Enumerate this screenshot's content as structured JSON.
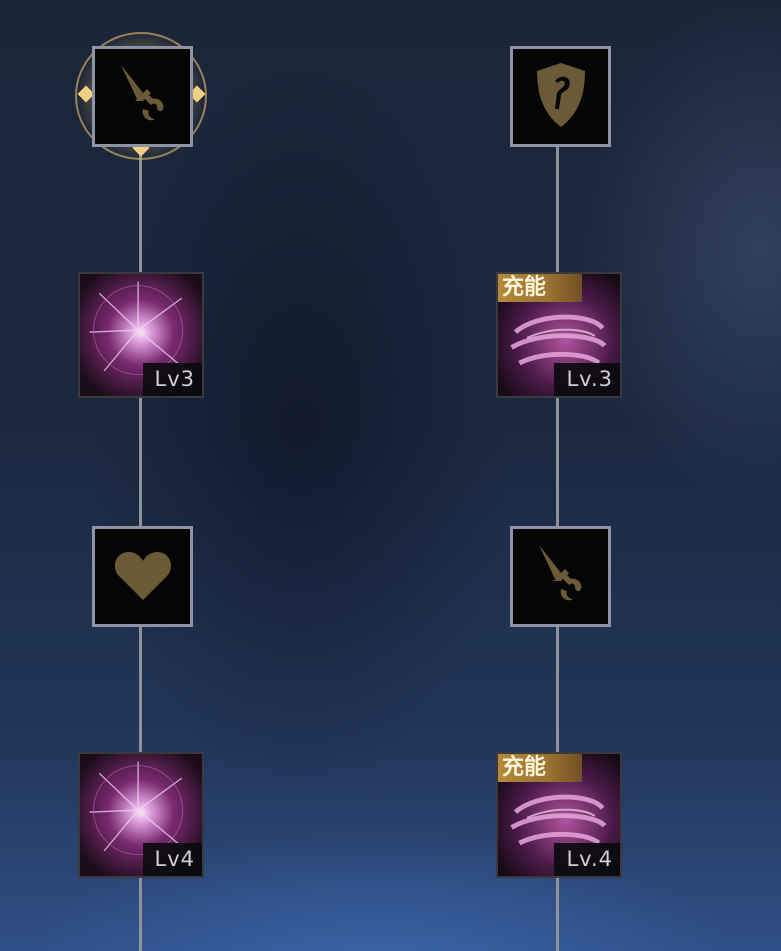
{
  "colors": {
    "frame": "#8f93a6",
    "glyph": "#6a5a38",
    "charge_tag": "#b58a3c",
    "halo": "#caa865"
  },
  "left_column": {
    "node1": {
      "icon": "sword-icon",
      "selected": true
    },
    "node2": {
      "icon": "purple-burst-skill-icon",
      "level": "Lv3"
    },
    "node3": {
      "icon": "heart-icon"
    },
    "node4": {
      "icon": "purple-burst-skill-icon",
      "level": "Lv4"
    }
  },
  "right_column": {
    "node1": {
      "icon": "shield-icon"
    },
    "node2": {
      "icon": "purple-swirl-skill-icon",
      "tag": "充能",
      "level": "Lv.3"
    },
    "node3": {
      "icon": "sword-icon"
    },
    "node4": {
      "icon": "purple-swirl-skill-icon",
      "tag": "充能",
      "level": "Lv.4"
    }
  }
}
